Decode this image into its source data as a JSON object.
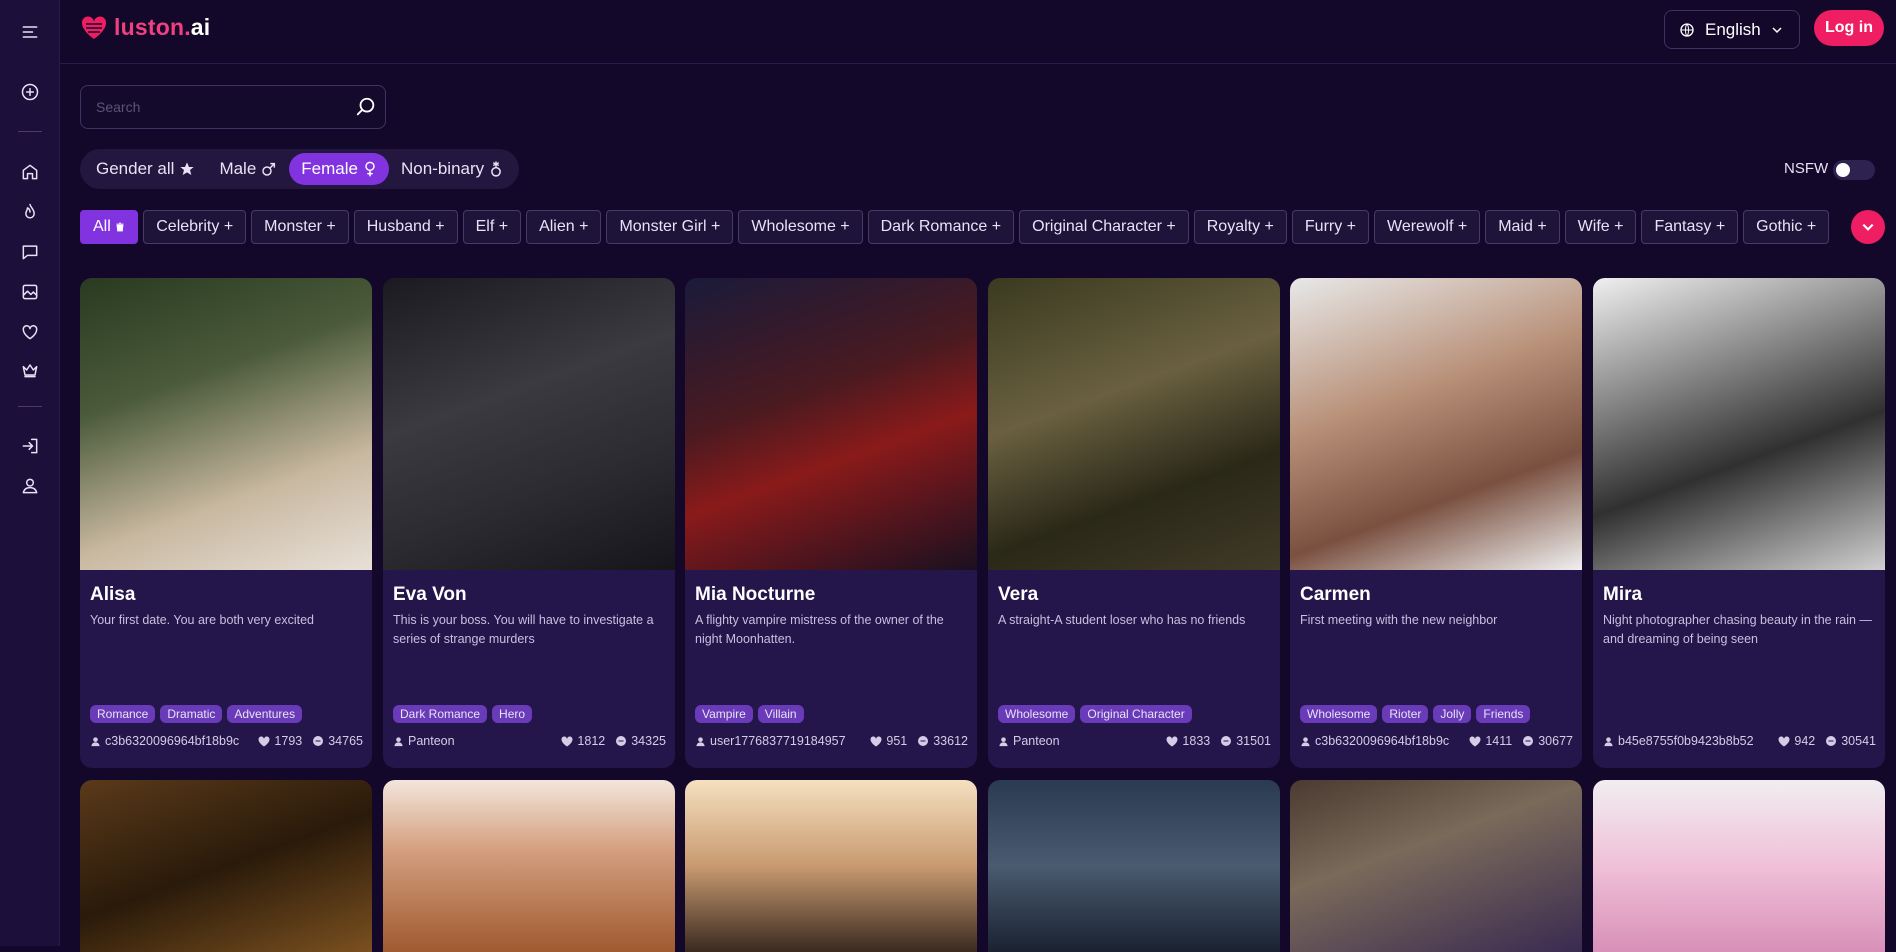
{
  "logo": {
    "part1": "luston.",
    "part2": "ai"
  },
  "header": {
    "language": "English",
    "login_label": "Log in"
  },
  "search": {
    "placeholder": "Search"
  },
  "gender": [
    {
      "label": "Gender all",
      "icon": "star-icon",
      "active": false
    },
    {
      "label": "Male",
      "icon": "male-icon",
      "active": false
    },
    {
      "label": "Female",
      "icon": "female-icon",
      "active": true
    },
    {
      "label": "Non-binary",
      "icon": "nonbinary-icon",
      "active": false
    }
  ],
  "nsfw": {
    "label": "NSFW",
    "enabled": false
  },
  "tags": [
    "All",
    "Celebrity +",
    "Monster +",
    "Husband +",
    "Elf +",
    "Alien +",
    "Monster Girl +",
    "Wholesome +",
    "Dark Romance +",
    "Original Character +",
    "Royalty +",
    "Furry +",
    "Werewolf +",
    "Maid +",
    "Wife +",
    "Fantasy +",
    "Gothic +"
  ],
  "colors": {
    "background": "#13082a",
    "sidebar": "#1c0f3a",
    "accent": "#8133e0",
    "brand": "#ef1e62",
    "card": "#24154a",
    "tag": "#6a3bb8"
  },
  "cards": [
    {
      "name": "Alisa",
      "desc": "Your first date. You are both very excited",
      "tags": [
        "Romance",
        "Dramatic",
        "Adventures"
      ],
      "author": "c3b6320096964bf18b9c",
      "likes": "1793",
      "chats": "34765"
    },
    {
      "name": "Eva Von",
      "desc": "This is your boss. You will have to investigate a series of strange murders",
      "tags": [
        "Dark Romance",
        "Hero"
      ],
      "author": "Panteon",
      "likes": "1812",
      "chats": "34325"
    },
    {
      "name": "Mia Nocturne",
      "desc": "A flighty vampire mistress of the owner of the night Moonhatten.",
      "tags": [
        "Vampire",
        "Villain"
      ],
      "author": "user1776837719184957",
      "likes": "951",
      "chats": "33612"
    },
    {
      "name": "Vera",
      "desc": "A straight-A student loser who has no friends",
      "tags": [
        "Wholesome",
        "Original Character"
      ],
      "author": "Panteon",
      "likes": "1833",
      "chats": "31501"
    },
    {
      "name": "Carmen",
      "desc": "First meeting with the new neighbor",
      "tags": [
        "Wholesome",
        "Rioter",
        "Jolly",
        "Friends"
      ],
      "author": "c3b6320096964bf18b9c",
      "likes": "1411",
      "chats": "30677"
    },
    {
      "name": "Mira",
      "desc": "Night photographer chasing beauty in the rain — and dreaming of being seen",
      "tags": [],
      "author": "b45e8755f0b9423b8b52",
      "likes": "942",
      "chats": "30541"
    }
  ]
}
